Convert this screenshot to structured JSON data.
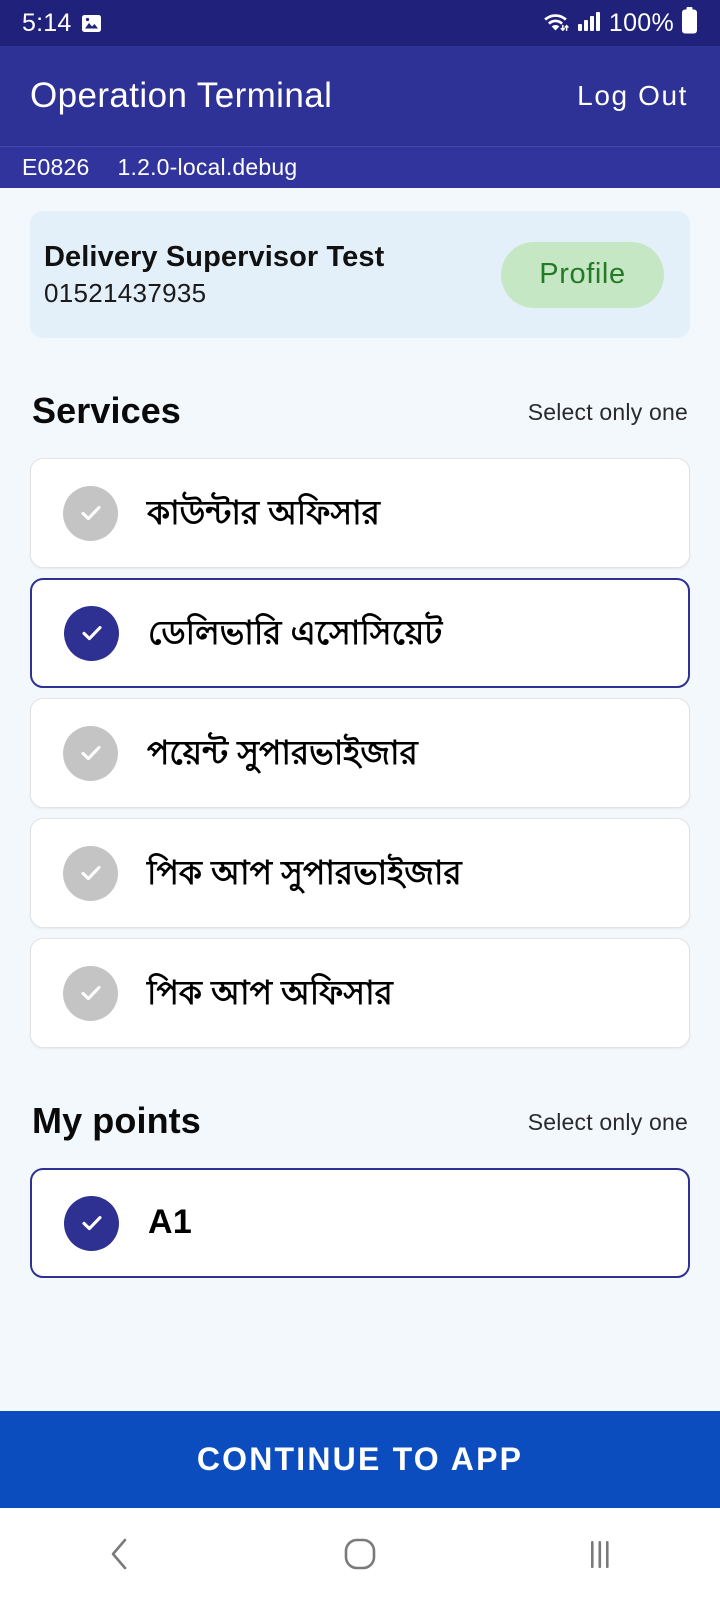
{
  "status_bar": {
    "time": "5:14",
    "image_icon": "image-icon",
    "wifi_icon": "wifi-icon",
    "signal_icon": "cellular-signal-icon",
    "battery_text": "100%",
    "battery_icon": "battery-full-icon"
  },
  "app_bar": {
    "title": "Operation Terminal",
    "logout_label": "Log Out",
    "background_color": "#2E3196"
  },
  "version_bar": {
    "device_code": "E0826",
    "version": "1.2.0-local.debug"
  },
  "profile": {
    "name": "Delivery Supervisor Test",
    "phone": "01521437935",
    "button_label": "Profile",
    "button_bg_color": "#C6E7C4",
    "button_text_color": "#257A27",
    "card_bg_color": "#E3EFF9"
  },
  "services": {
    "title": "Services",
    "hint": "Select only one",
    "items": [
      {
        "label": "কাউন্টার অফিসার",
        "selected": false
      },
      {
        "label": "ডেলিভারি এসোসিয়েট",
        "selected": true
      },
      {
        "label": "পয়েন্ট সুপারভাইজার",
        "selected": false
      },
      {
        "label": "পিক আপ সুপারভাইজার",
        "selected": false
      },
      {
        "label": "পিক আপ অফিসার",
        "selected": false
      }
    ]
  },
  "my_points": {
    "title": "My points",
    "hint": "Select only one",
    "items": [
      {
        "label": "A1",
        "selected": true
      }
    ]
  },
  "cta": {
    "label": "CONTINUE TO APP",
    "color": "#0B4DBF"
  },
  "nav_bar": {
    "back_icon": "back-chevron-icon",
    "home_icon": "home-circle-icon",
    "recents_icon": "recent-apps-icon"
  },
  "theme": {
    "page_background": "#F2F8FC",
    "selected_accent": "#2E3192",
    "unselected_gray": "#C4C4C4"
  }
}
